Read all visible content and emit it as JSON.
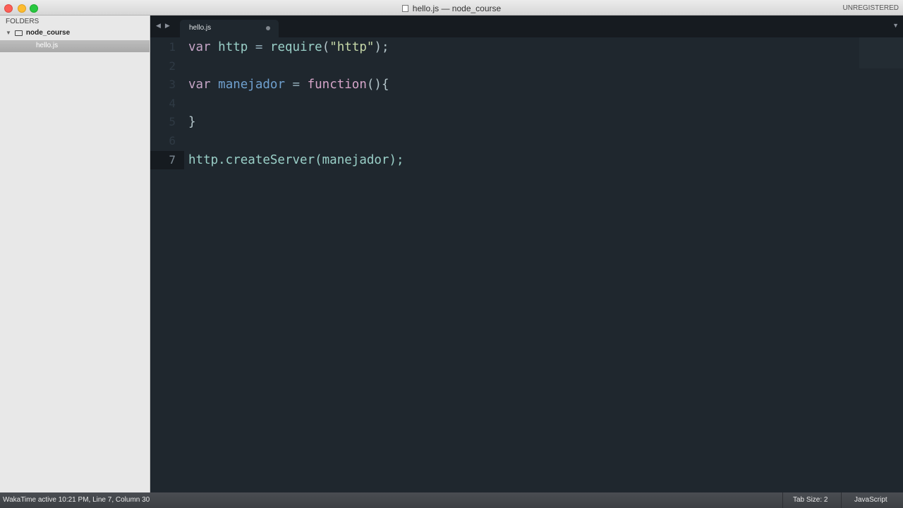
{
  "window": {
    "title": "hello.js — node_course",
    "badge": "UNREGISTERED"
  },
  "sidebar": {
    "header": "FOLDERS",
    "folder": "node_course",
    "files": [
      "hello.js"
    ]
  },
  "tabs": [
    {
      "label": "hello.js",
      "dirty": true
    }
  ],
  "editor": {
    "current_line": 7,
    "lines": [
      {
        "n": "1",
        "tokens": [
          [
            "kw",
            "var "
          ],
          [
            "id",
            "http "
          ],
          [
            "op",
            "= "
          ],
          [
            "id",
            "require"
          ],
          [
            "pn",
            "("
          ],
          [
            "str",
            "\"http\""
          ],
          [
            "pn",
            ");"
          ]
        ]
      },
      {
        "n": "2",
        "tokens": []
      },
      {
        "n": "3",
        "tokens": [
          [
            "kw",
            "var "
          ],
          [
            "var2",
            "manejador "
          ],
          [
            "op",
            "= "
          ],
          [
            "fn",
            "function"
          ],
          [
            "pn",
            "(){"
          ]
        ]
      },
      {
        "n": "4",
        "tokens": []
      },
      {
        "n": "5",
        "tokens": [
          [
            "pn",
            "}"
          ]
        ]
      },
      {
        "n": "6",
        "tokens": []
      },
      {
        "n": "7",
        "tokens": [
          [
            "id",
            "http.createServer(manejador);"
          ]
        ]
      }
    ]
  },
  "status": {
    "left": "WakaTime active 10:21 PM, Line 7, Column 30",
    "tab_size": "Tab Size: 2",
    "syntax": "JavaScript"
  }
}
